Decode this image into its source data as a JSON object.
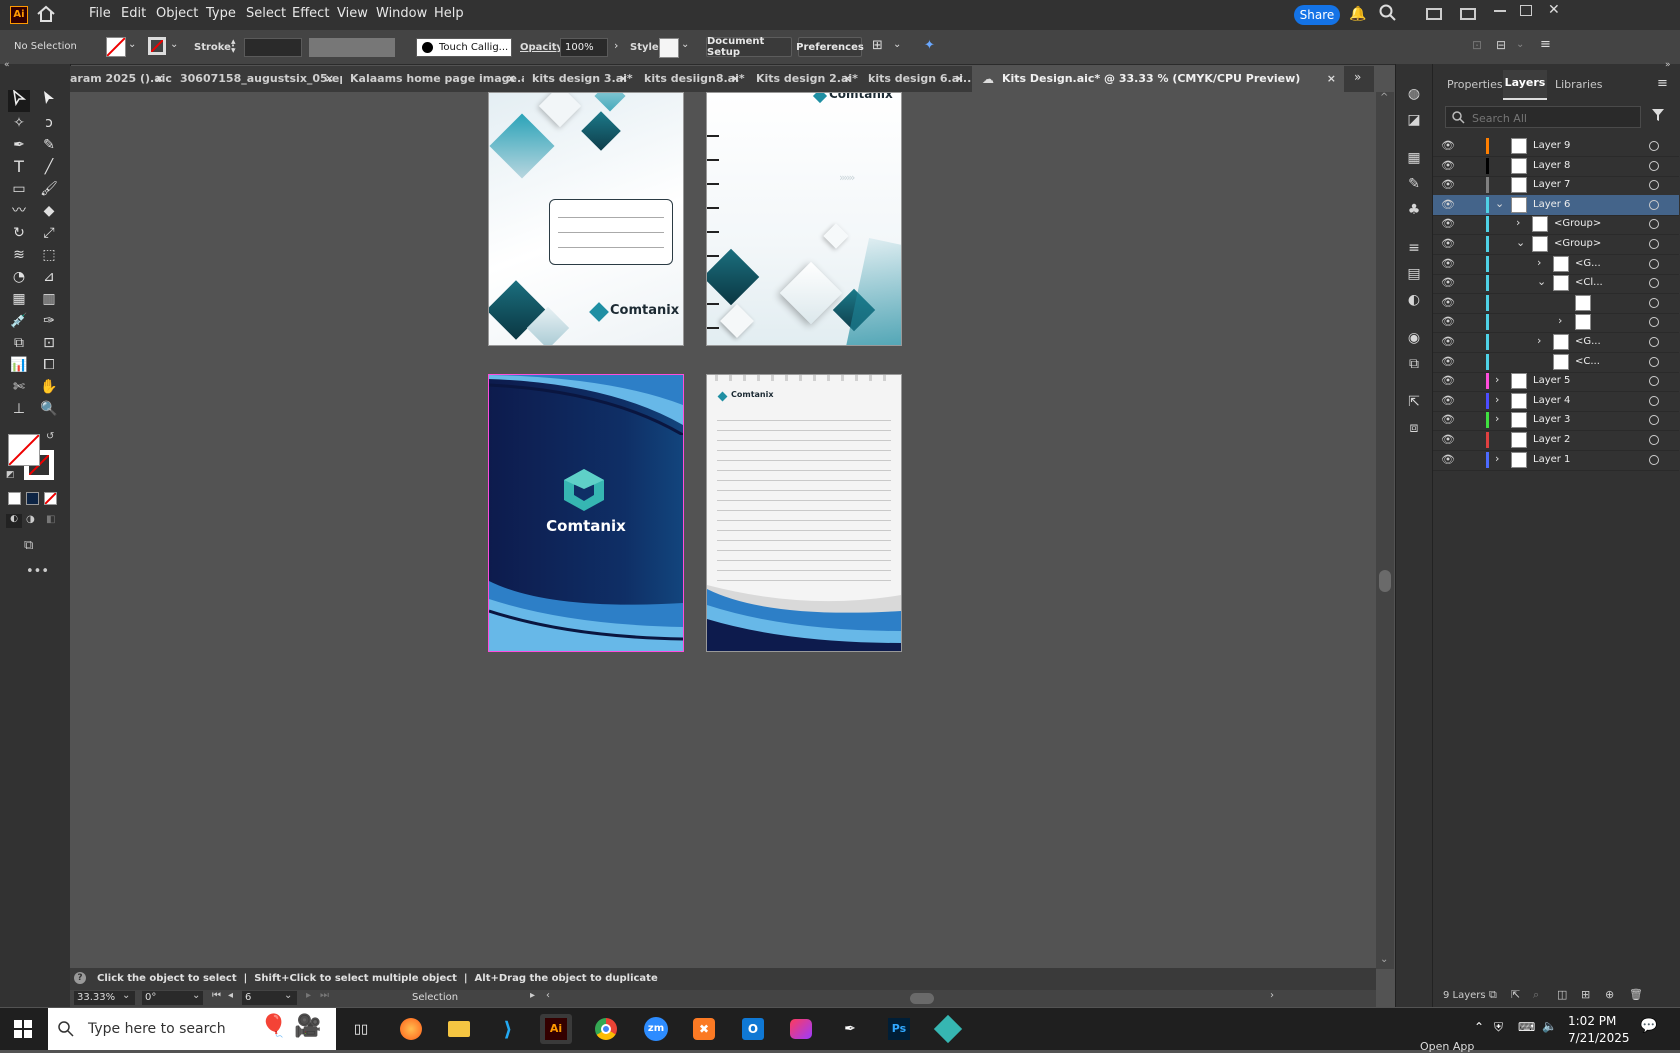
{
  "app": {
    "logo": "Ai",
    "accent": "#ff9a00"
  },
  "menu": [
    "File",
    "Edit",
    "Object",
    "Type",
    "Select",
    "Effect",
    "View",
    "Window",
    "Help"
  ],
  "share_label": "Share",
  "control": {
    "selection": "No Selection",
    "stroke_label": "Stroke:",
    "brush": "Touch Callig...",
    "opacity_label": "Opacity:",
    "opacity_value": "100%",
    "style_label": "Style:",
    "doc_setup": "Document Setup",
    "preferences": "Preferences"
  },
  "tabs": [
    {
      "label": "aram 2025 ().aic"
    },
    {
      "label": "30607158_augustsix_05.eps*"
    },
    {
      "label": "Kalaams home page image.ai*"
    },
    {
      "label": "kits design 3.ai*"
    },
    {
      "label": "kits desiign8.ai*"
    },
    {
      "label": "Kits design 2.ai*"
    },
    {
      "label": "kits design 6.ai..."
    },
    {
      "label": "Kits Design.aic* @ 33.33 % (CMYK/CPU Preview)"
    }
  ],
  "artwork": {
    "brand": "Comtanix"
  },
  "panel": {
    "tabs": [
      "Properties",
      "Layers",
      "Libraries"
    ],
    "search_placeholder": "Search All",
    "layers": [
      {
        "name": "Layer 9",
        "color": "#ff7f00",
        "level": 0,
        "twist": ""
      },
      {
        "name": "Layer 8",
        "color": "#000000",
        "level": 0,
        "twist": ""
      },
      {
        "name": "Layer 7",
        "color": "#808080",
        "level": 0,
        "twist": ""
      },
      {
        "name": "Layer 6",
        "color": "#4fd2e6",
        "level": 0,
        "twist": "⌄",
        "selected": true
      },
      {
        "name": "<Group>",
        "color": "#4fd2e6",
        "level": 1,
        "twist": "›"
      },
      {
        "name": "<Group>",
        "color": "#4fd2e6",
        "level": 1,
        "twist": "⌄"
      },
      {
        "name": "<G...",
        "color": "#4fd2e6",
        "level": 2,
        "twist": "›"
      },
      {
        "name": "<Cl...",
        "color": "#4fd2e6",
        "level": 2,
        "twist": "⌄"
      },
      {
        "name": "",
        "color": "#4fd2e6",
        "level": 3,
        "twist": ""
      },
      {
        "name": "",
        "color": "#4fd2e6",
        "level": 3,
        "twist": "›"
      },
      {
        "name": "<G...",
        "color": "#4fd2e6",
        "level": 2,
        "twist": "›"
      },
      {
        "name": "<C...",
        "color": "#4fd2e6",
        "level": 2,
        "twist": ""
      },
      {
        "name": "Layer 5",
        "color": "#ff4ddb",
        "level": 0,
        "twist": "›"
      },
      {
        "name": "Layer 4",
        "color": "#4d4dff",
        "level": 0,
        "twist": "›"
      },
      {
        "name": "Layer 3",
        "color": "#40e040",
        "level": 0,
        "twist": "›"
      },
      {
        "name": "Layer 2",
        "color": "#e04040",
        "level": 0,
        "twist": ""
      },
      {
        "name": "Layer 1",
        "color": "#4d6bff",
        "level": 0,
        "twist": "›"
      }
    ],
    "layer_count": "9 Layers"
  },
  "status": {
    "hint": "Click the object to select  |  Shift+Click to select multiple object  |  Alt+Drag the object to duplicate",
    "zoom": "33.33%",
    "rotate": "0°",
    "artboard": "6",
    "tool": "Selection"
  },
  "taskbar": {
    "search_placeholder": "Type here to search",
    "time": "1:02 PM",
    "date": "7/21/2025",
    "open_app": "Open App"
  }
}
